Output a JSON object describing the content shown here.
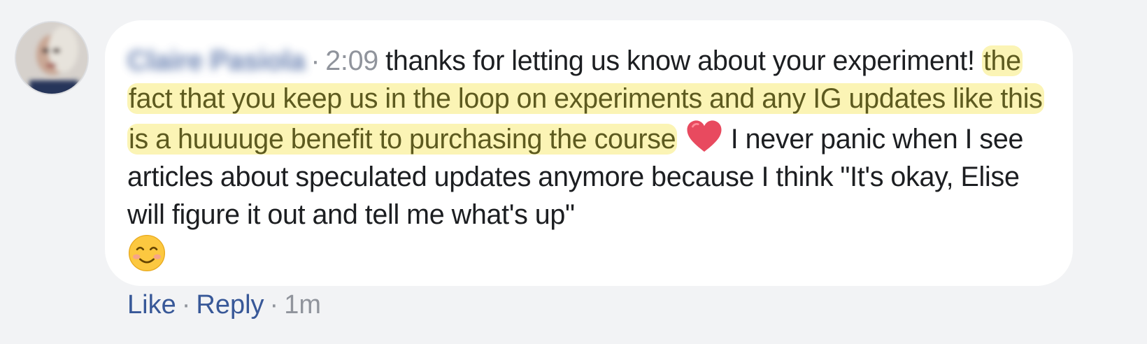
{
  "comment": {
    "author": "Claire Pasiola",
    "time": "2:09",
    "separator": "·",
    "text_before": "thanks for letting us know about your experiment!",
    "highlight": "the fact that you keep us in the loop on experiments and any IG updates like this is a huuuuge benefit to purchasing the course",
    "text_after": "I never panic when I see articles about speculated updates anymore because I think \"It's okay, Elise will figure it out and tell me what's up\"",
    "emoji_1": "heart-emoji",
    "emoji_2": "smiling-face-emoji",
    "highlight_color": "#fbf4b5",
    "highlight_text_color": "#5d5a1f"
  },
  "actions": {
    "like": "Like",
    "reply": "Reply",
    "age": "1m",
    "separator": "·"
  },
  "colors": {
    "background": "#f2f3f5",
    "bubble": "#ffffff",
    "link": "#385898",
    "meta": "#90949c",
    "text": "#1c1e21"
  }
}
